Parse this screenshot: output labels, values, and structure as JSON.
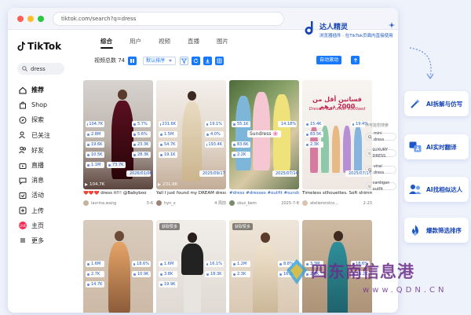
{
  "browser": {
    "url": "tiktok.com/search?q=dress",
    "dot_colors": [
      "#ff5f57",
      "#febc2e",
      "#28c840"
    ]
  },
  "sidebar": {
    "logo_text": "TikTok",
    "search_value": "dress",
    "items": [
      {
        "label": "推荐",
        "icon": "home-icon",
        "active": true
      },
      {
        "label": "Shop",
        "icon": "shop-bag-icon"
      },
      {
        "label": "探索",
        "icon": "compass-icon"
      },
      {
        "label": "已关注",
        "icon": "user-plus-icon"
      },
      {
        "label": "好友",
        "icon": "friends-icon"
      },
      {
        "label": "直播",
        "icon": "live-tv-icon"
      },
      {
        "label": "消息",
        "icon": "message-icon"
      },
      {
        "label": "活动",
        "icon": "activity-icon"
      },
      {
        "label": "上传",
        "icon": "upload-icon"
      },
      {
        "label": "主页",
        "icon": "profile-live-icon",
        "badge": "LIVE"
      },
      {
        "label": "更多",
        "icon": "more-icon"
      }
    ]
  },
  "tabs": [
    {
      "label": "综合",
      "active": true
    },
    {
      "label": "用户"
    },
    {
      "label": "视频"
    },
    {
      "label": "直播"
    },
    {
      "label": "图片"
    }
  ],
  "toolbar": {
    "total_label": "视频总数 74",
    "sort_label": "默认排序",
    "auto_button": "自动滚动"
  },
  "brand": {
    "name": "达人精灵",
    "subtitle": "浏览器插件 · 在TikTok页面内直接使用"
  },
  "videos": [
    {
      "views": "104.7K",
      "stats": [
        "104.7K",
        "5.7%",
        "2.8M",
        "5.6%",
        "19.6K",
        "23.3K",
        "10.5K",
        "28.3K",
        "1.1M",
        "73.7K",
        "2026/01/06"
      ],
      "caption": "❤️❤️❤️ dress it!!! @Babyboo",
      "author": "lavrina.wang",
      "date": "5-6",
      "tag": ""
    },
    {
      "views": "231.6K",
      "stats": [
        "231.6K",
        "19.1%",
        "1.5M",
        "4.0%",
        "54.7K",
        "193.4K",
        "19.1K",
        "2025/09/17"
      ],
      "caption": "Yall I just found my DREAM dress 🥺",
      "author": "hyn_x",
      "date": "4 周前",
      "tag": ""
    },
    {
      "views": "",
      "stats": [
        "55.1K",
        "14.18%",
        "83.6K",
        "2.2K",
        "2025/07/14"
      ],
      "caption": "#dress #dresses #outfit #sundress",
      "author": "skus_bem",
      "date": "2025-7-8",
      "tag": ""
    },
    {
      "views": "",
      "stats": [
        "15.4K",
        "19.4%",
        "83.5K",
        "2.3K",
        "2025/07/14"
      ],
      "caption": "Timeless silhouettes. Soft shimmer. E...",
      "author": "atelierorolco...",
      "date": "2-23",
      "tag": ""
    },
    {
      "views": "",
      "stats": [
        "1.6M",
        "18.6%",
        "2.7K",
        "10.9K",
        "14.7K"
      ],
      "caption": "",
      "author": "",
      "date": "",
      "tag": ""
    },
    {
      "views": "",
      "stats": [
        "1.6M",
        "16.1%",
        "3.8K",
        "18.3K",
        "19.9K"
      ],
      "caption": "",
      "author": "",
      "date": "",
      "tag": "获取赞多"
    },
    {
      "views": "",
      "stats": [
        "1.2M",
        "8.8%",
        "2.3K",
        "16.2K"
      ],
      "caption": "",
      "author": "",
      "date": "",
      "tag": "获取赞多"
    },
    {
      "views": "",
      "stats": [
        "3.3M",
        "18.6%",
        "2.1K",
        "16.2K"
      ],
      "caption": "",
      "author": "",
      "date": "",
      "tag": ""
    }
  ],
  "overlay_texts": {
    "sundress": "Sundress 🌸",
    "arabic_line": "فساتين أقل من 2000 درهم",
    "english_line": "Dresses that under 2000aed"
  },
  "related": {
    "title": "你可能想搜索",
    "items": [
      "mini dress",
      "LUXURY DRESS",
      "viral dress",
      "cardigan outfit"
    ]
  },
  "features": [
    {
      "label": "AI拆解与仿写",
      "icon": "magic-wand-icon"
    },
    {
      "label": "AI实时翻译",
      "icon": "translate-icon"
    },
    {
      "label": "AI找相似达人",
      "icon": "similar-users-icon"
    },
    {
      "label": "爆款筛选排序",
      "icon": "fire-icon"
    }
  ],
  "watermark": {
    "text": "四东南信息港",
    "sub": "www.QDN.CN"
  },
  "colors": {
    "accent": "#1677ff",
    "brand": "#1745b6"
  }
}
